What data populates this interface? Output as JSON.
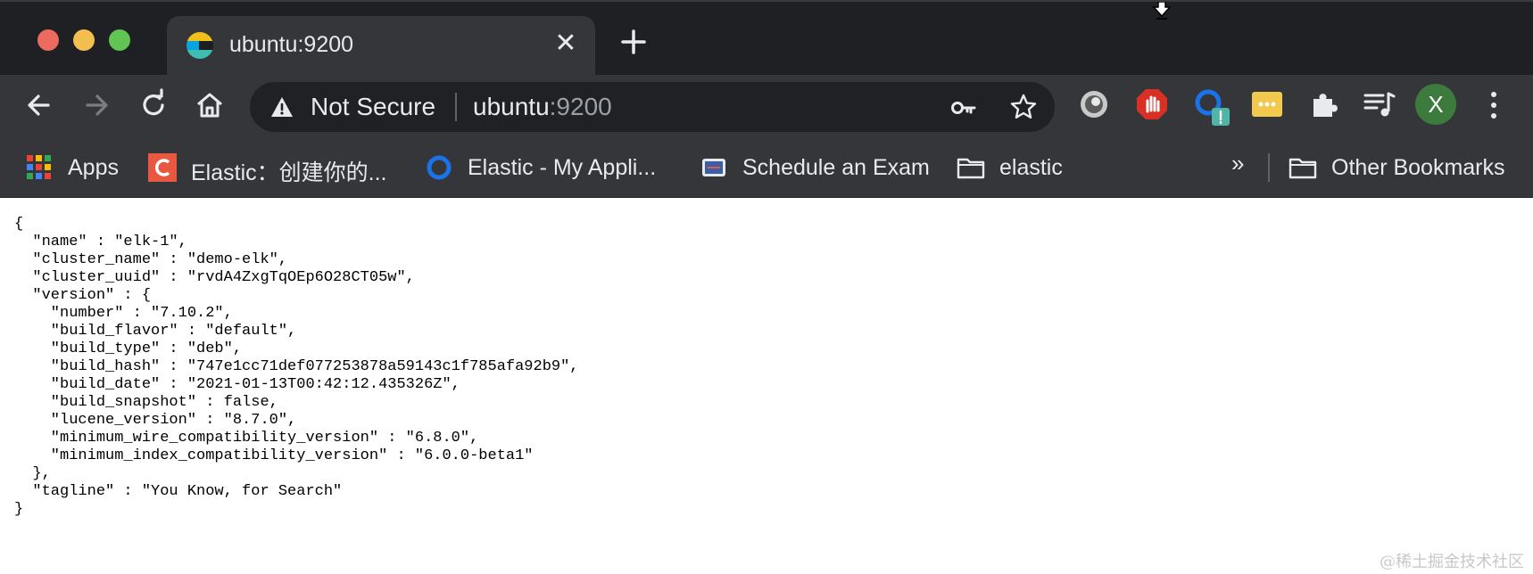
{
  "tab": {
    "title": "ubuntu:9200",
    "close_label": "✕"
  },
  "toolbar": {
    "security_label": "Not Secure",
    "url_host": "ubuntu",
    "url_port": ":9200",
    "avatar_letter": "X"
  },
  "bookmarks": {
    "items": [
      {
        "label": "Apps",
        "icon": "apps-grid-icon"
      },
      {
        "label": "Elastic：创建你的...",
        "icon": "elastic-c-icon"
      },
      {
        "label": "Elastic - My Appli...",
        "icon": "elastic-ring-icon"
      },
      {
        "label": "Schedule an Exam",
        "icon": "exam-icon"
      },
      {
        "label": "elastic",
        "icon": "folder-icon"
      }
    ],
    "more_label": "»",
    "other_label": "Other Bookmarks"
  },
  "content": {
    "json_text": "{\n  \"name\" : \"elk-1\",\n  \"cluster_name\" : \"demo-elk\",\n  \"cluster_uuid\" : \"rvdA4ZxgTqOEp6O28CT05w\",\n  \"version\" : {\n    \"number\" : \"7.10.2\",\n    \"build_flavor\" : \"default\",\n    \"build_type\" : \"deb\",\n    \"build_hash\" : \"747e1cc71def077253878a59143c1f785afa92b9\",\n    \"build_date\" : \"2021-01-13T00:42:12.435326Z\",\n    \"build_snapshot\" : false,\n    \"lucene_version\" : \"8.7.0\",\n    \"minimum_wire_compatibility_version\" : \"6.8.0\",\n    \"minimum_index_compatibility_version\" : \"6.0.0-beta1\"\n  },\n  \"tagline\" : \"You Know, for Search\"\n}"
  },
  "watermark": "@稀土掘金技术社区",
  "colors": {
    "tab_strip": "#1f2023",
    "toolbar": "#35363a",
    "omnibox": "#202124",
    "text": "#e8eaed"
  }
}
